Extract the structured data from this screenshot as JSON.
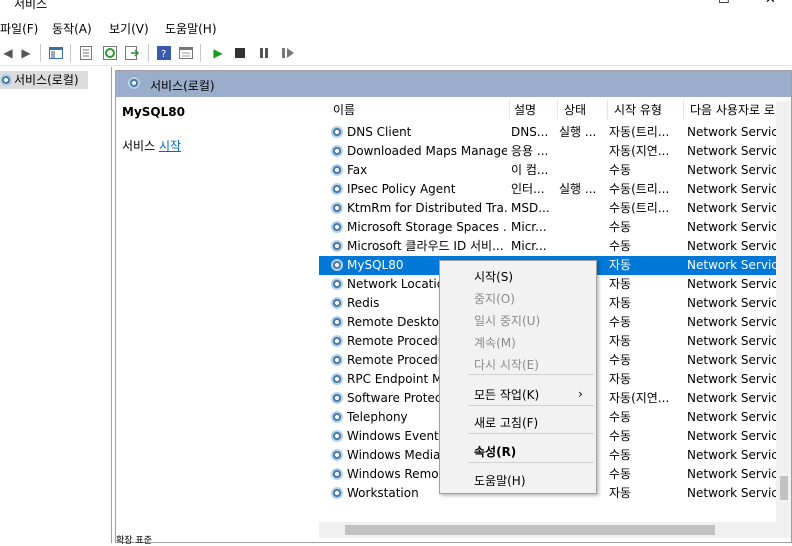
{
  "window": {
    "title": "서비스",
    "minimize": "—",
    "maximize": "☐",
    "close": "✕"
  },
  "menu": [
    "파일(F)",
    "동작(A)",
    "보기(V)",
    "도움말(H)"
  ],
  "tree": {
    "root_label": "서비스(로컬)"
  },
  "header": {
    "label": "서비스(로컬)"
  },
  "description": {
    "title": "MySQL80",
    "prefix": "서비스 ",
    "link": "시작"
  },
  "columns": [
    "이름",
    "설명",
    "상태",
    "시작 유형",
    "다음 사용자로 로"
  ],
  "rows": [
    {
      "name": "DNS Client",
      "desc": "DNS...",
      "status": "실행 ...",
      "startup": "자동(트리...",
      "logon": "Network Service"
    },
    {
      "name": "Downloaded Maps Manager",
      "desc": "응용 ...",
      "status": "",
      "startup": "자동(지연...",
      "logon": "Network Service"
    },
    {
      "name": "Fax",
      "desc": "이 컴...",
      "status": "",
      "startup": "수동",
      "logon": "Network Service"
    },
    {
      "name": "IPsec Policy Agent",
      "desc": "인터...",
      "status": "실행 ...",
      "startup": "수동(트리...",
      "logon": "Network Service"
    },
    {
      "name": "KtmRm for Distributed Tra...",
      "desc": "MSD...",
      "status": "",
      "startup": "수동(트리...",
      "logon": "Network Service"
    },
    {
      "name": "Microsoft Storage Spaces ...",
      "desc": "Micr...",
      "status": "",
      "startup": "수동",
      "logon": "Network Service"
    },
    {
      "name": "Microsoft 클라우드 ID 서비...",
      "desc": "Micr...",
      "status": "",
      "startup": "수동",
      "logon": "Network Service"
    },
    {
      "name": "MySQL80",
      "desc": "",
      "status": "",
      "startup": "자동",
      "logon": "Network Service",
      "selected": true
    },
    {
      "name": "Network Locatio",
      "desc": "",
      "status": "",
      "startup": "자동",
      "logon": "Network Service"
    },
    {
      "name": "Redis",
      "desc": "",
      "status": "",
      "startup": "자동",
      "logon": "Network Service"
    },
    {
      "name": "Remote Desktop",
      "desc": "",
      "status": "",
      "startup": "수동",
      "logon": "Network Service"
    },
    {
      "name": "Remote Procedu",
      "desc": "",
      "status": "",
      "startup": "자동",
      "logon": "Network Service"
    },
    {
      "name": "Remote Procedu",
      "desc": "",
      "status": "",
      "startup": "수동",
      "logon": "Network Service"
    },
    {
      "name": "RPC Endpoint M",
      "desc": "",
      "status": "",
      "startup": "자동",
      "logon": "Network Service"
    },
    {
      "name": "Software Protect",
      "desc": "",
      "status": "",
      "startup": "자동(지연...",
      "logon": "Network Service"
    },
    {
      "name": "Telephony",
      "desc": "",
      "status": "",
      "startup": "수동",
      "logon": "Network Service"
    },
    {
      "name": "Windows Event C",
      "desc": "",
      "status": "",
      "startup": "수동",
      "logon": "Network Service"
    },
    {
      "name": "Windows Media",
      "desc": "",
      "status": "",
      "startup": "수동",
      "logon": "Network Service"
    },
    {
      "name": "Windows Remot",
      "desc": "",
      "status": "",
      "startup": "수동",
      "logon": "Network Service"
    },
    {
      "name": "Workstation",
      "desc": "",
      "status": "",
      "startup": "자동",
      "logon": "Network Service"
    }
  ],
  "context_menu": [
    {
      "label": "시작(S)",
      "disabled": false,
      "bold": false
    },
    {
      "label": "중지(O)",
      "disabled": true,
      "bold": false
    },
    {
      "label": "일시 중지(U)",
      "disabled": true,
      "bold": false
    },
    {
      "label": "계속(M)",
      "disabled": true,
      "bold": false
    },
    {
      "label": "다시 시작(E)",
      "disabled": true,
      "bold": false
    },
    {
      "label": "모든 작업(K)",
      "disabled": false,
      "bold": false,
      "submenu": true
    },
    {
      "label": "새로 고침(F)",
      "disabled": false,
      "bold": false
    },
    {
      "label": "속성(R)",
      "disabled": false,
      "bold": true
    },
    {
      "label": "도움말(H)",
      "disabled": false,
      "bold": false
    }
  ],
  "bottom_tabs": "확장 표준",
  "colors": {
    "selection": "#0078d7",
    "header": "#9aaecb",
    "link": "#0066cc"
  }
}
